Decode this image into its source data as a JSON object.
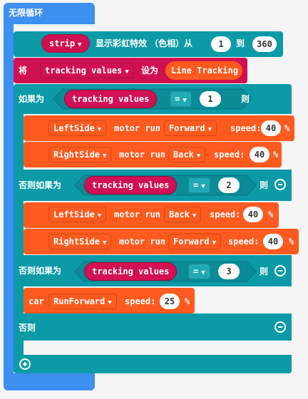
{
  "loop": {
    "label": "无限循环"
  },
  "strip_block": {
    "variable": "strip",
    "text_a": "显示彩虹特效 （色相）从",
    "from": "1",
    "text_b": "到",
    "to": "360"
  },
  "set_block": {
    "prefix": "将",
    "variable": "tracking values",
    "text": "设为",
    "value": "Line Tracking"
  },
  "if_block": {
    "if_label": "如果为",
    "then_label": "则",
    "elseif_label": "否则如果为",
    "else_label": "否则",
    "operator": "=",
    "var": "tracking values",
    "cond1": "1",
    "cond2": "2",
    "cond3": "3"
  },
  "motor": {
    "run_text": "motor run",
    "speed_text": "speed:",
    "percent": "%",
    "b1": {
      "side": "LeftSide",
      "dir": "Forward",
      "speed": "40"
    },
    "b2": {
      "side": "RightSide",
      "dir": "Back",
      "speed": "40"
    },
    "b3": {
      "side": "LeftSide",
      "dir": "Back",
      "speed": "40"
    },
    "b4": {
      "side": "RightSide",
      "dir": "Forward",
      "speed": "40"
    }
  },
  "car": {
    "label": "car",
    "action": "RunForward",
    "speed_text": "speed:",
    "speed": "25",
    "percent": "%"
  }
}
